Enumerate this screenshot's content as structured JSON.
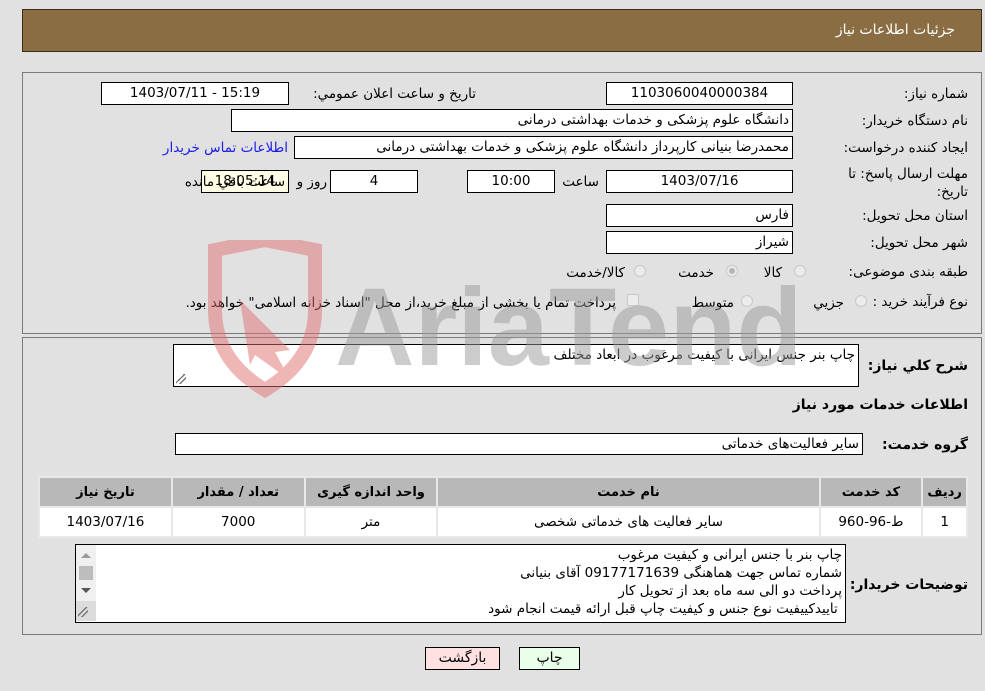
{
  "header": {
    "title": "جزئیات اطلاعات نیاز"
  },
  "details": {
    "need_number_label": "شماره نیاز:",
    "need_number": "1103060040000384",
    "announce_label": "تاریخ و ساعت اعلان عمومي:",
    "announce_value": "1403/07/11 - 15:19",
    "buyer_org_label": "نام دستگاه خریدار:",
    "buyer_org": "دانشگاه علوم پزشکی و خدمات بهداشتی درمانی",
    "creator_label": "ایجاد کننده درخواست:",
    "creator": "محمدرضا بنیانی کارپرداز دانشگاه علوم پزشکی و خدمات بهداشتی درمانی",
    "contact_link": "اطلاعات تماس خریدار",
    "deadline_label": "مهلت ارسال پاسخ: تا تاریخ:",
    "deadline_date": "1403/07/16",
    "time_label": "ساعت",
    "deadline_time": "10:00",
    "days_value": "4",
    "days_label": "روز و",
    "remaining_time": "18:05:14",
    "remaining_label": "ساعت باقي مانده",
    "province_label": "استان محل تحویل:",
    "province": "فارس",
    "city_label": "شهر محل تحویل:",
    "city": "شیراز",
    "category_label": "طبقه بندی موضوعی:",
    "category_options": [
      {
        "label": "کالا",
        "checked": false
      },
      {
        "label": "خدمت",
        "checked": true
      },
      {
        "label": "کالا/خدمت",
        "checked": false
      }
    ],
    "process_label": "نوع فرآیند خرید :",
    "process_options": [
      {
        "label": "جزيي",
        "checked": false
      },
      {
        "label": "متوسط",
        "checked": false
      }
    ],
    "treasury_note": "پرداخت تمام یا بخشی از مبلغ خرید،از محل \"اسناد خزانه اسلامی\" خواهد بود."
  },
  "services": {
    "summary_label": "شرح کلي نیاز:",
    "summary": "چاپ بنر جنس ایرانی با کیفیت مرغوب در ابعاد مختلف",
    "section_title": "اطلاعات خدمات مورد نیاز",
    "group_label": "گروه خدمت:",
    "group": "سایر فعالیت‌های خدماتی",
    "table": {
      "headers": [
        "ردیف",
        "کد خدمت",
        "نام خدمت",
        "واحد اندازه گیری",
        "تعداد / مقدار",
        "تاریخ نیاز"
      ],
      "rows": [
        [
          "1",
          "ط-96-960",
          "سایر فعالیت های خدماتی شخصی",
          "متر",
          "7000",
          "1403/07/16"
        ]
      ]
    },
    "buyer_notes_label": "توضیحات خریدار:",
    "buyer_notes": [
      "چاپ بنر با جنس ایرانی و کیفیت مرغوب",
      "شماره تماس جهت هماهنگی 09177171639 آقای بنیانی",
      "پرداخت دو الی سه ماه بعد از تحویل کار",
      " تاییدکییفیت نوع جنس و کیفیت چاپ قبل ارائه قیمت انجام شود"
    ]
  },
  "buttons": {
    "print": "چاپ",
    "back": "بازگشت"
  },
  "watermark": {
    "text": "AriaTender.neT"
  },
  "colors": {
    "header_bg": "#8b6d43",
    "print_bg": "#eaffea",
    "back_bg": "#ffe1e1",
    "link": "#1b1be8"
  }
}
